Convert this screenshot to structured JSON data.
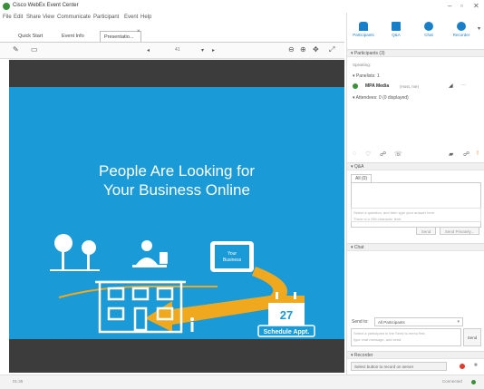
{
  "window": {
    "title": "Cisco WebEx Event Center",
    "min": "–",
    "max": "▫",
    "close": "✕"
  },
  "menu": [
    "File",
    "Edit",
    "Share",
    "View",
    "Communicate",
    "Participant",
    "Event",
    "Help"
  ],
  "tabs": [
    {
      "label": "Quick Start"
    },
    {
      "label": "Event Info"
    },
    {
      "label": "Presentatio...",
      "active": true
    }
  ],
  "tab_close": "×",
  "toolbar": {
    "page": "41"
  },
  "slide": {
    "title_line1": "People Are Looking for",
    "title_line2": "Your Business Online",
    "phone_line1": "Your",
    "phone_line2": "Business",
    "calendar_day": "27",
    "calendar_caption": "Schedule Appt.",
    "bg_color": "#1a9ad6",
    "accent_color": "#f0a91e"
  },
  "panel": {
    "tools": [
      {
        "icon": "participants-icon",
        "label": "Participants"
      },
      {
        "icon": "q-and-a-icon",
        "label": "Q&A"
      },
      {
        "icon": "chat-icon",
        "label": "Chat"
      },
      {
        "icon": "recorder-icon",
        "label": "Recorder"
      }
    ],
    "participants_header": "▾ Participants (3)",
    "speaking": "Speaking:",
    "panelists": "▾ Panelists: 1",
    "mpa_name": "MPA Media",
    "mpa_role": "(Host, me)",
    "attendees": "▾ Attendees: 0 (0 displayed)",
    "qa_header": "▾ Q&A",
    "qa_tab": "All (0)",
    "qa_placeholder_1": "Select a question, and then type your answer here.",
    "qa_placeholder_2": "There is a 256-character limit.",
    "qa_send": "Send",
    "qa_send_private": "Send Privately...",
    "chat_header": "▾ Chat",
    "send_to_label": "Send to:",
    "send_to_value": "All Participants",
    "chat_placeholder_1": "Select a participant in the Send to menu first,",
    "chat_placeholder_2": "type chat message, and send.",
    "chat_send": "Send",
    "recorder_header": "▾ Recorder",
    "recorder_text": "Select button to record on server",
    "connected": "Connected"
  },
  "status": {
    "time": "01:35"
  }
}
